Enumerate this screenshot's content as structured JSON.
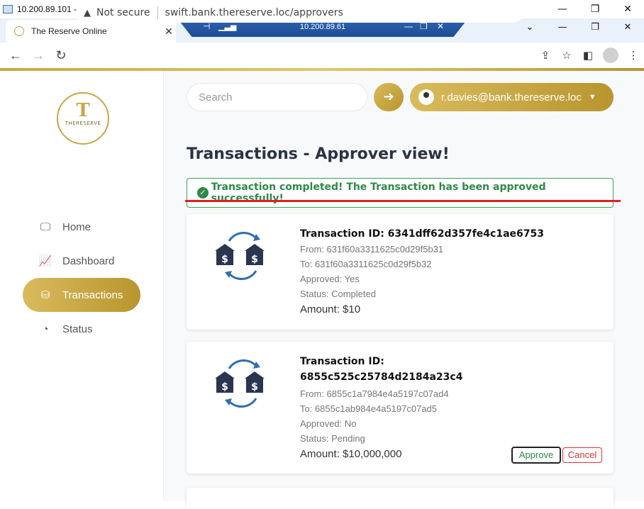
{
  "rdp": {
    "window_title": "10.200.89.101 - Remote Desktop Connection",
    "connection_bar_ip": "10.200.89.61"
  },
  "browser": {
    "tab_title": "The Reserve Online",
    "security_label": "Not secure",
    "url": "swift.bank.thereserve.loc/approvers"
  },
  "sidebar": {
    "logo_text": "THERESERVE",
    "items": [
      {
        "label": "Home",
        "icon": "monitor-icon",
        "active": false
      },
      {
        "label": "Dashboard",
        "icon": "chart-line-icon",
        "active": false
      },
      {
        "label": "Transactions",
        "icon": "coins-icon",
        "active": true
      },
      {
        "label": "Status",
        "icon": "pie-chart-icon",
        "active": false
      }
    ]
  },
  "header": {
    "search_placeholder": "Search",
    "user_email": "r.davies@bank.thereserve.loc"
  },
  "main": {
    "title": "Transactions - Approver view!",
    "alert": "Transaction completed! The Transaction has been approved successfully!",
    "transactions": [
      {
        "id_line": "Transaction ID: 6341dff62d357fe4c1ae6753",
        "from": "From: 631f60a3311625c0d29f5b31",
        "to": "To: 631f60a3311625c0d29f5b32",
        "approved": "Approved: Yes",
        "status": "Status: Completed",
        "amount": "Amount: $10"
      },
      {
        "id_label": "Transaction ID:",
        "id_value": "6855c525c25784d2184a23c4",
        "from": "From: 6855c1a7984e4a5197c07ad4",
        "to": "To: 6855c1ab984e4a5197c07ad5",
        "approved": "Approved: No",
        "status": "Status: Pending",
        "amount": "Amount: $10,000,000",
        "approve_label": "Approve",
        "cancel_label": "Cancel"
      }
    ]
  },
  "colors": {
    "gold": "#c9a54a",
    "success": "#2d8a47",
    "danger": "#d33333",
    "annotation_red": "#e0201f",
    "icon_blue": "#2f6fb0"
  }
}
